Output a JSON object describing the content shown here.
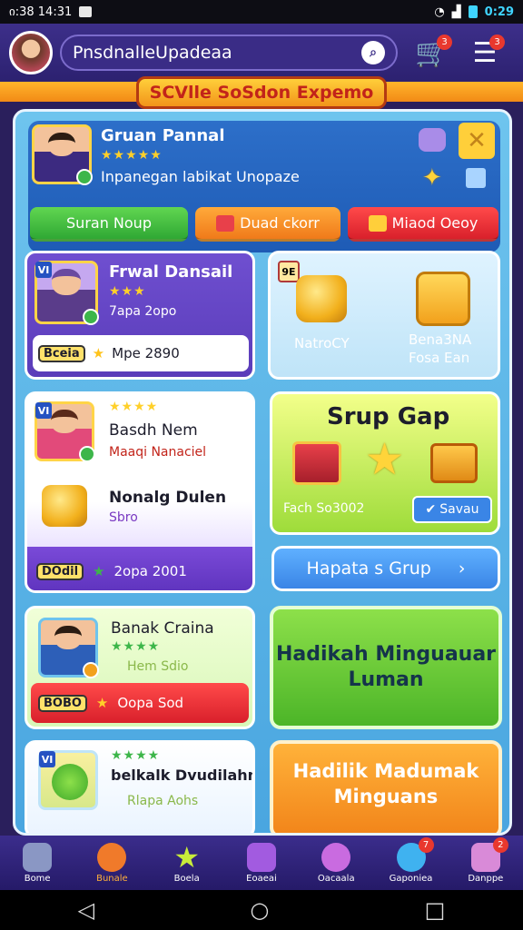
{
  "status_bar": {
    "time_left": "ი:38 14:31",
    "time_right": "0:29"
  },
  "header": {
    "search_text": "PnsdnalleUpadeaa",
    "cart_badge": "3",
    "menu_badge": "3"
  },
  "banner": {
    "title": "SCVlle SoSdon Expemo"
  },
  "profile": {
    "name": "Gruan Pannal",
    "stars": "★★★★★",
    "subtitle": "Inpanegan labikat Unopaze",
    "buttons": [
      {
        "label": "Suran Noup",
        "color": "#3db64a"
      },
      {
        "label": "Duad ckorr",
        "color": "#f58a1f"
      },
      {
        "label": "Miaod Oeoy",
        "color": "#e02a33"
      }
    ]
  },
  "friend_card": {
    "corner": "VI",
    "name": "Frwal Dansail",
    "stars": "★★★",
    "meta": "7apa 2opo",
    "tag": "Bceia",
    "value": "Mpe 2890"
  },
  "rewards_card": {
    "corner": "9E",
    "left_label": "NatroCY",
    "right_label_1": "Bena3NA",
    "right_label_2": "Fosa Ean"
  },
  "second_card": {
    "corner": "VI",
    "stars": "★★★★",
    "name": "Basdh Nem",
    "meta": "Maaqi Nanaciel",
    "name2": "Nonalg Dulen",
    "meta2": "Sbro",
    "tag": "DOdil",
    "value": "2opa 2001"
  },
  "group_card": {
    "title": "Srup Gap",
    "label": "Fach So3002",
    "button": "Savau"
  },
  "group_button": {
    "label": "Hapata s Grup"
  },
  "third_card": {
    "name": "Banak Craina",
    "stars": "★★★★",
    "meta": "Hem Sdio",
    "tag": "BOBO",
    "value": "Oopa Sod"
  },
  "big_green": {
    "line1": "Hadikah Minguauar",
    "line2": "Luman"
  },
  "fourth_card": {
    "corner": "VI",
    "stars": "★★★★",
    "name": "belkalk Dvudilahn",
    "meta": "Rlapa Aohs"
  },
  "big_orange": {
    "line1": "Hadilik Madumak",
    "line2": "Minguans"
  },
  "bottom_nav": [
    {
      "label": "Bome",
      "color": "#8a97c4",
      "badge": ""
    },
    {
      "label": "Bunale",
      "color": "#f07a2a",
      "badge": ""
    },
    {
      "label": "Boela",
      "color": "#9edc3a",
      "badge": ""
    },
    {
      "label": "Eoaeai",
      "color": "#a25be0",
      "badge": ""
    },
    {
      "label": "Oacaala",
      "color": "#c96be0",
      "badge": ""
    },
    {
      "label": "Gaponiea",
      "color": "#3fb2f0",
      "badge": "7"
    },
    {
      "label": "Danppe",
      "color": "#d98ad8",
      "badge": "2"
    }
  ]
}
